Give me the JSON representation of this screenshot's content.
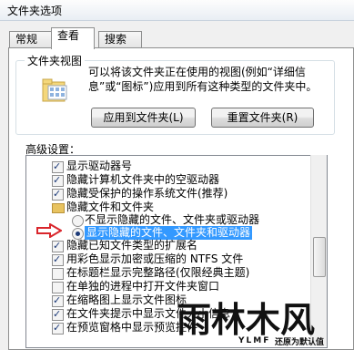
{
  "window": {
    "title": "文件夹选项"
  },
  "tabs": [
    {
      "label": "常规"
    },
    {
      "label": "查看"
    },
    {
      "label": "搜索"
    }
  ],
  "folder_views": {
    "group_title": "文件夹视图",
    "description": "可以将该文件夹正在使用的视图(例如“详细信息”或“图标”)应用到所有这种类型的文件夹中。",
    "apply_button": "应用到文件夹(L)",
    "reset_button": "重置文件夹(R)"
  },
  "advanced": {
    "label": "高级设置：",
    "items": [
      {
        "type": "checkbox",
        "checked": true,
        "label": "显示驱动器号"
      },
      {
        "type": "checkbox",
        "checked": true,
        "label": "隐藏计算机文件夹中的空驱动器"
      },
      {
        "type": "checkbox",
        "checked": true,
        "label": "隐藏受保护的操作系统文件(推荐)"
      },
      {
        "type": "folder",
        "label": "隐藏文件和文件夹"
      },
      {
        "type": "radio",
        "selected": false,
        "label": "不显示隐藏的文件、文件夹或驱动器"
      },
      {
        "type": "radio",
        "selected": true,
        "label": "显示隐藏的文件、文件夹和驱动器"
      },
      {
        "type": "checkbox",
        "checked": true,
        "label": "隐藏已知文件类型的扩展名"
      },
      {
        "type": "checkbox",
        "checked": true,
        "label": "用彩色显示加密或压缩的 NTFS 文件"
      },
      {
        "type": "checkbox",
        "checked": false,
        "label": "在标题栏显示完整路径(仅限经典主题)"
      },
      {
        "type": "checkbox",
        "checked": false,
        "label": "在单独的进程中打开文件夹窗口"
      },
      {
        "type": "checkbox",
        "checked": true,
        "label": "在缩略图上显示文件图标"
      },
      {
        "type": "checkbox",
        "checked": true,
        "label": "在文件夹提示中显示文件大小信息"
      },
      {
        "type": "checkbox",
        "checked": true,
        "label": "在预览窗格中显示预览控件"
      }
    ]
  },
  "watermark": {
    "main": "雨林木风",
    "sub": "YLMF",
    "tail": "还原为默认值"
  },
  "colors": {
    "selection": "#3399ff",
    "arrow": "#d9262c"
  }
}
